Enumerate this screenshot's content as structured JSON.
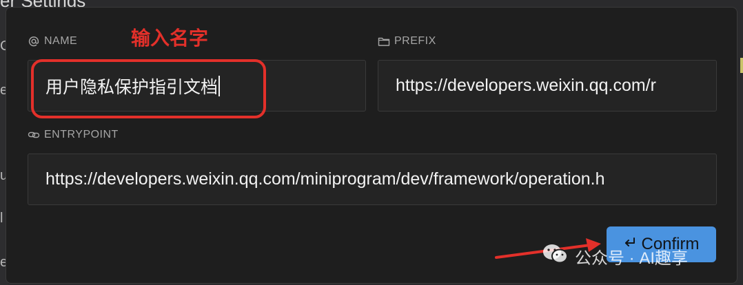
{
  "background": {
    "title": "er Settings",
    "left_letters": [
      "C",
      "e",
      "",
      "u",
      "l",
      "e"
    ]
  },
  "fields": {
    "name": {
      "label": "NAME",
      "icon": "at-icon",
      "value": "用户隐私保护指引文档"
    },
    "prefix": {
      "label": "PREFIX",
      "icon": "folder-icon",
      "value": "https://developers.weixin.qq.com/r"
    },
    "entrypoint": {
      "label": "ENTRYPOINT",
      "icon": "link-icon",
      "value": "https://developers.weixin.qq.com/miniprogram/dev/framework/operation.h"
    }
  },
  "annotation": {
    "text": "输入名字",
    "color": "#e3302a"
  },
  "confirm": {
    "label": "Confirm",
    "icon": "return-icon",
    "color": "#4a93e0"
  },
  "watermark": {
    "text": "公众号 · AI趣享",
    "icon": "wechat-icon"
  }
}
